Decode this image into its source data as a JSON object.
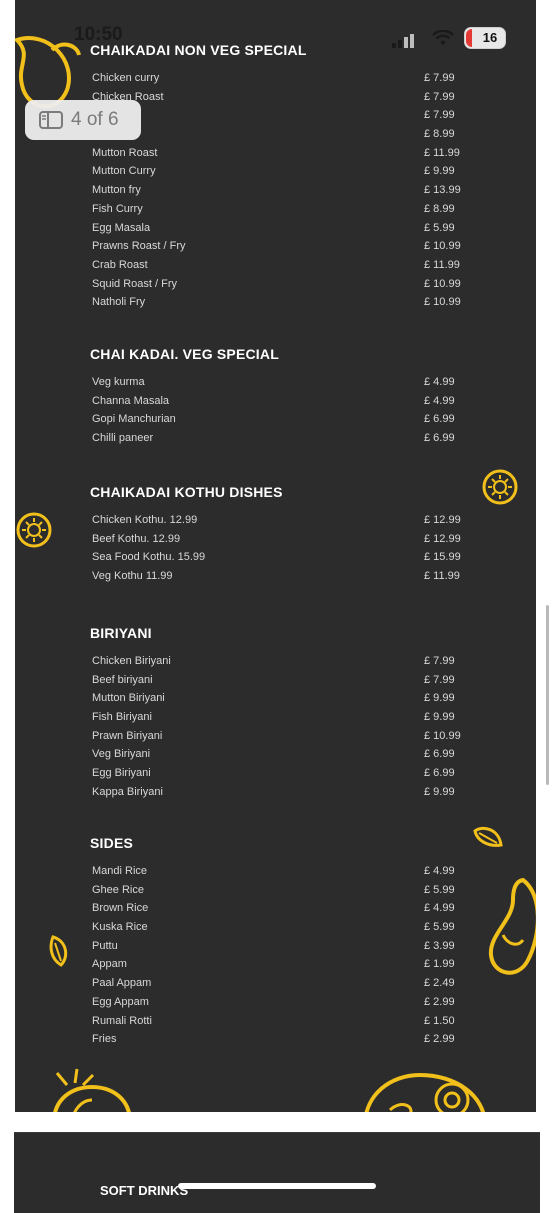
{
  "status_bar": {
    "time": "10:50",
    "battery_level": "16"
  },
  "page_indicator": {
    "label": "4 of 6"
  },
  "menu": {
    "sections": [
      {
        "title": "CHAIKADAI NON VEG SPECIAL",
        "items": [
          {
            "name": "Chicken curry",
            "price": "£ 7.99"
          },
          {
            "name": "Chicken Roast",
            "price": "£ 7.99"
          },
          {
            "name": "",
            "price": "£ 7.99"
          },
          {
            "name": "",
            "price": "£ 8.99"
          },
          {
            "name": "Mutton Roast",
            "price": "£ 11.99"
          },
          {
            "name": "Mutton Curry",
            "price": "£ 9.99"
          },
          {
            "name": "Mutton fry",
            "price": "£ 13.99"
          },
          {
            "name": "Fish Curry",
            "price": "£ 8.99"
          },
          {
            "name": "Egg Masala",
            "price": "£ 5.99"
          },
          {
            "name": "Prawns Roast / Fry",
            "price": "£ 10.99"
          },
          {
            "name": "Crab Roast",
            "price": "£ 11.99"
          },
          {
            "name": "Squid Roast / Fry",
            "price": "£ 10.99"
          },
          {
            "name": "Natholi Fry",
            "price": "£ 10.99"
          }
        ]
      },
      {
        "title": "CHAI KADAI. VEG SPECIAL",
        "items": [
          {
            "name": "Veg kurma",
            "price": "£ 4.99"
          },
          {
            "name": "Channa Masala",
            "price": "£ 4.99"
          },
          {
            "name": "Gopi Manchurian",
            "price": "£ 6.99"
          },
          {
            "name": "Chilli paneer",
            "price": "£ 6.99"
          }
        ]
      },
      {
        "title": "CHAIKADAI KOTHU DISHES",
        "items": [
          {
            "name": "Chicken Kothu. 12.99",
            "price": "£ 12.99"
          },
          {
            "name": "Beef Kothu. 12.99",
            "price": "£ 12.99"
          },
          {
            "name": "Sea Food Kothu. 15.99",
            "price": "£ 15.99"
          },
          {
            "name": "Veg Kothu 11.99",
            "price": "£ 11.99"
          }
        ]
      },
      {
        "title": "BIRIYANI",
        "items": [
          {
            "name": "Chicken Biriyani",
            "price": "£ 7.99"
          },
          {
            "name": "Beef biriyani",
            "price": "£ 7.99"
          },
          {
            "name": "Mutton Biriyani",
            "price": "£ 9.99"
          },
          {
            "name": "Fish Biriyani",
            "price": "£ 9.99"
          },
          {
            "name": "Prawn Biriyani",
            "price": "£ 10.99"
          },
          {
            "name": "Veg Biriyani",
            "price": "£ 6.99"
          },
          {
            "name": "Egg Biriyani",
            "price": "£ 6.99"
          },
          {
            "name": "Kappa Biriyani",
            "price": "£ 9.99"
          }
        ]
      },
      {
        "title": "SIDES",
        "items": [
          {
            "name": "Mandi Rice",
            "price": "£ 4.99"
          },
          {
            "name": "Ghee Rice",
            "price": "£ 5.99"
          },
          {
            "name": "Brown Rice",
            "price": "£ 4.99"
          },
          {
            "name": "Kuska Rice",
            "price": "£ 5.99"
          },
          {
            "name": "Puttu",
            "price": "£ 3.99"
          },
          {
            "name": "Appam",
            "price": "£ 1.99"
          },
          {
            "name": "Paal Appam",
            "price": "£ 2.49"
          },
          {
            "name": "Egg Appam",
            "price": "£ 2.99"
          },
          {
            "name": "Rumali Rotti",
            "price": "£ 1.50"
          },
          {
            "name": "Fries",
            "price": "£ 2.99"
          }
        ]
      }
    ],
    "next_page_title": "SOFT DRINKS"
  },
  "colors": {
    "background": "#2c2c2c",
    "accent": "#f2c01b",
    "text": "#d8d8d8"
  }
}
